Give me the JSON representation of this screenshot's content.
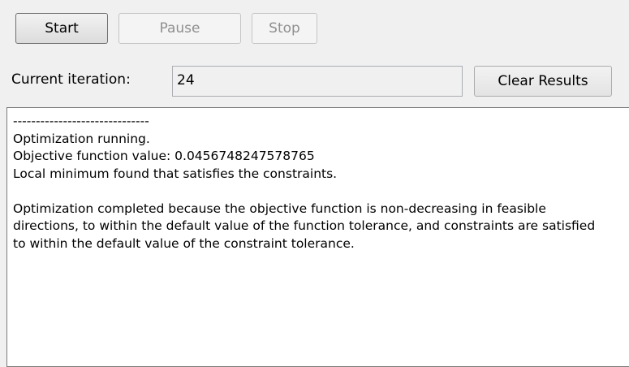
{
  "toolbar": {
    "start_label": "Start",
    "pause_label": "Pause",
    "stop_label": "Stop",
    "clear_label": "Clear Results"
  },
  "iteration": {
    "label": "Current iteration:",
    "value": "24"
  },
  "output": {
    "separator": "------------------------------",
    "status": "Optimization running.",
    "objective": "Objective function value: 0.0456748247578765",
    "minimum": "Local minimum found that satisfies the constraints.",
    "completion": "Optimization completed because the objective function is non-decreasing in feasible directions, to within the default value of the function tolerance, and constraints are satisfied to within the default value of the constraint tolerance."
  },
  "colors": {
    "background": "#f0f0f0",
    "output_background": "#ffffff",
    "disabled_text": "#8f8f8f"
  }
}
